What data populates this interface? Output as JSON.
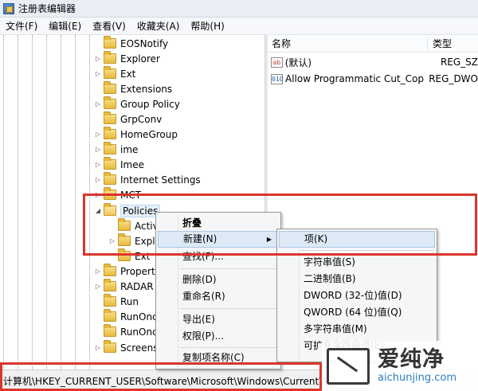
{
  "window": {
    "title": "注册表编辑器"
  },
  "menu": [
    "文件(F)",
    "编辑(E)",
    "查看(V)",
    "收藏夹(A)",
    "帮助(H)"
  ],
  "tree": {
    "items": [
      {
        "label": "EOSNotify",
        "expander": ""
      },
      {
        "label": "Explorer",
        "expander": "▷"
      },
      {
        "label": "Ext",
        "expander": "▷"
      },
      {
        "label": "Extensions",
        "expander": ""
      },
      {
        "label": "Group Policy",
        "expander": "▷"
      },
      {
        "label": "GrpConv",
        "expander": ""
      },
      {
        "label": "HomeGroup",
        "expander": "▷"
      },
      {
        "label": "ime",
        "expander": "▷"
      },
      {
        "label": "Imee",
        "expander": "▷"
      },
      {
        "label": "Internet Settings",
        "expander": "▷"
      },
      {
        "label": "MCT",
        "expander": "▷"
      },
      {
        "label": "Policies",
        "expander": "◢"
      },
      {
        "label": "Activ",
        "expander": ""
      },
      {
        "label": "Explo",
        "expander": "▷"
      },
      {
        "label": "Ext",
        "expander": ""
      },
      {
        "label": "Propert",
        "expander": "▷"
      },
      {
        "label": "RADAR",
        "expander": "▷"
      },
      {
        "label": "Run",
        "expander": ""
      },
      {
        "label": "RunOnc",
        "expander": ""
      },
      {
        "label": "RunOnc",
        "expander": ""
      },
      {
        "label": "Screens",
        "expander": "▷"
      }
    ]
  },
  "list": {
    "columns": [
      "名称",
      "类型"
    ],
    "rows": [
      {
        "icon": "ab",
        "name": "(默认)",
        "type": "REG_SZ"
      },
      {
        "icon": "010",
        "name": "Allow Programmatic Cut_Copy_...",
        "type": "REG_DWO"
      }
    ]
  },
  "context_menu": {
    "items": [
      "折叠",
      "新建(N)",
      "查找(F)...",
      "删除(D)",
      "重命名(R)",
      "导出(E)",
      "权限(P)...",
      "复制项名称(C)"
    ]
  },
  "submenu": {
    "items": [
      "项(K)",
      "字符串值(S)",
      "二进制值(B)",
      "DWORD (32-位)值(D)",
      "QWORD (64 位)值(Q)",
      "多字符串值(M)",
      "可扩充字符串值(E)"
    ]
  },
  "status": {
    "path": "计算机\\HKEY_CURRENT_USER\\Software\\Microsoft\\Windows\\CurrentVers"
  },
  "watermark": {
    "text_cn": "爱纯净",
    "url": "aichunjing.com"
  },
  "colors": {
    "highlight": "#d9362e",
    "selection": "#e5f0fb",
    "menu_hover": "#dde9f6"
  },
  "icons": {
    "app": "regedit-icon",
    "folder": "folder-icon",
    "string_value": "reg-sz-icon",
    "dword_value": "reg-dword-icon",
    "submenu_arrow": "arrow-right-icon"
  }
}
